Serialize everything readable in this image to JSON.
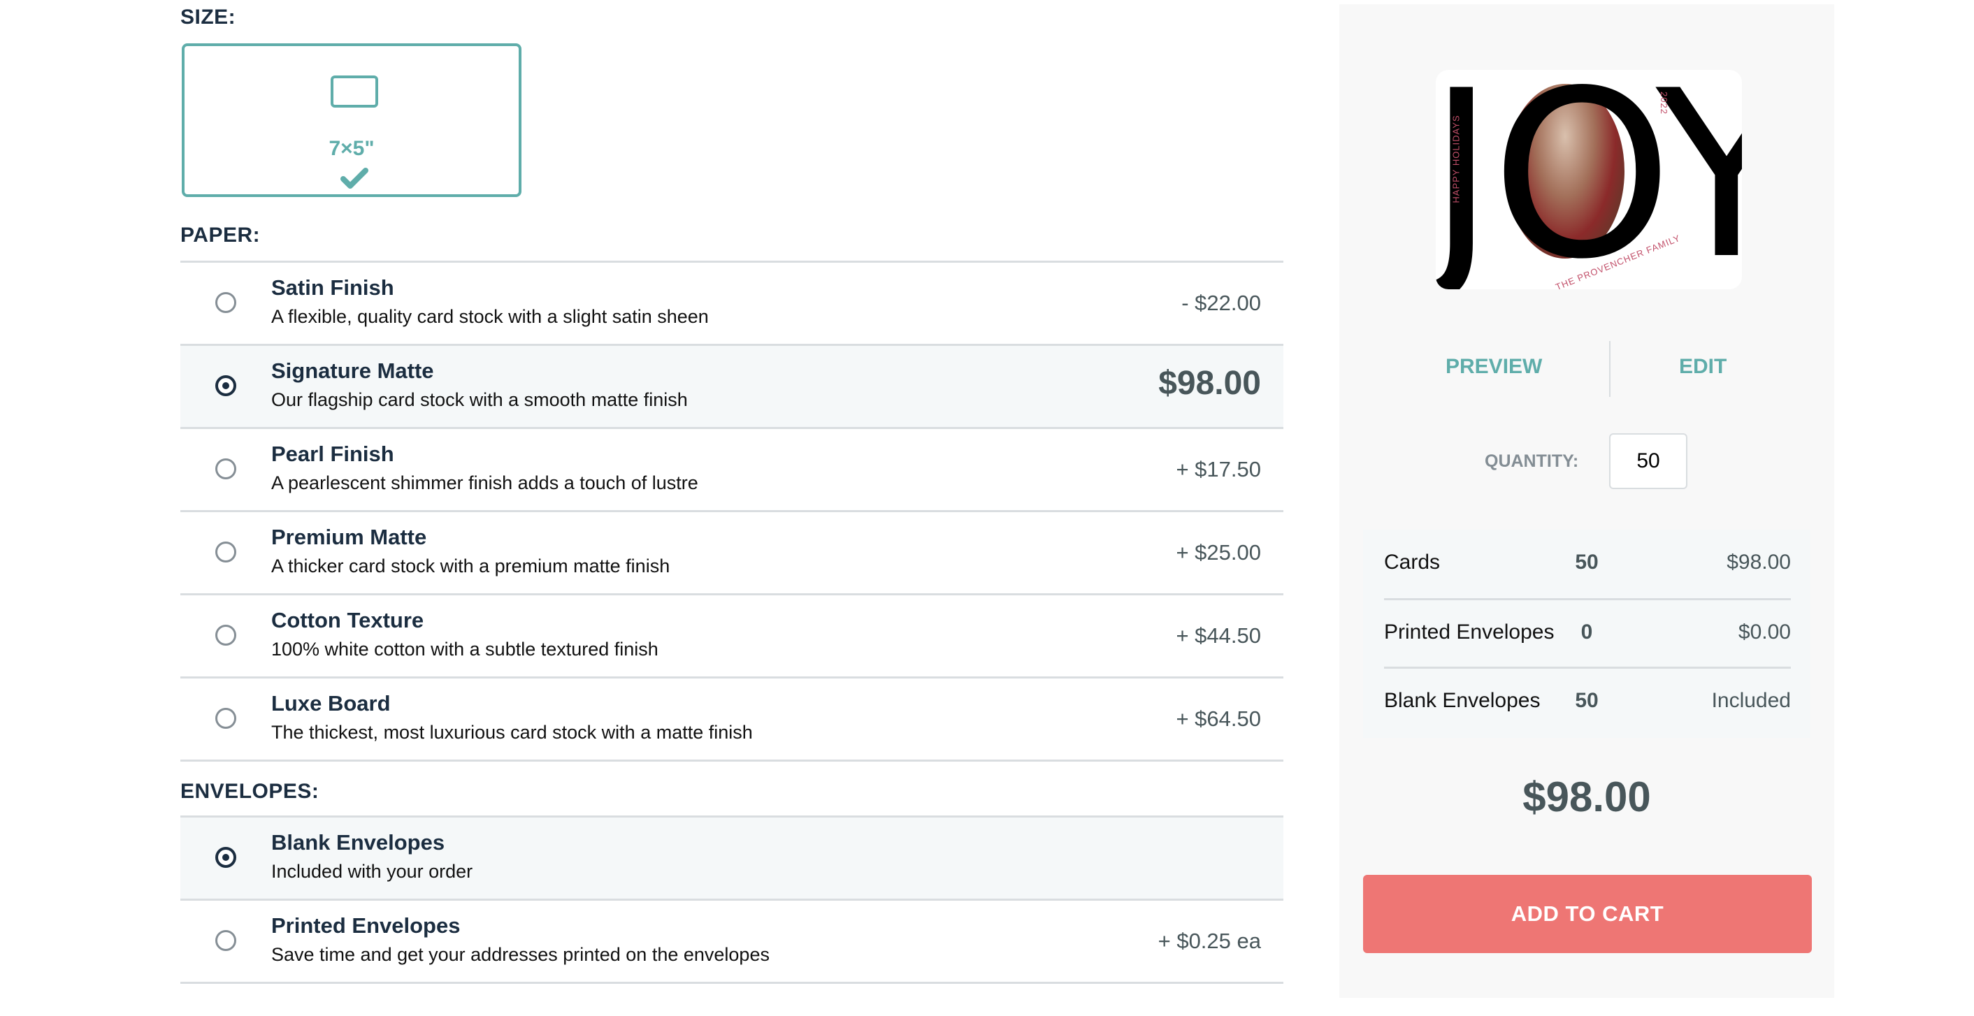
{
  "size": {
    "label": "SIZE:",
    "options": [
      {
        "label": "7×5\"",
        "icon": "card-landscape-icon",
        "selected": true
      }
    ]
  },
  "paper": {
    "label": "PAPER:",
    "options": [
      {
        "title": "Satin Finish",
        "description": "A flexible, quality card stock with a slight satin sheen",
        "price": "- $22.00",
        "selected": false
      },
      {
        "title": "Signature Matte",
        "description": "Our flagship card stock with a smooth matte finish",
        "price": "$98.00",
        "selected": true
      },
      {
        "title": "Pearl Finish",
        "description": "A pearlescent shimmer finish adds a touch of lustre",
        "price": "+ $17.50",
        "selected": false
      },
      {
        "title": "Premium Matte",
        "description": "A thicker card stock with a premium matte finish",
        "price": "+ $25.00",
        "selected": false
      },
      {
        "title": "Cotton Texture",
        "description": "100% white cotton with a subtle textured finish",
        "price": "+ $44.50",
        "selected": false
      },
      {
        "title": "Luxe Board",
        "description": "The thickest, most luxurious card stock with a matte finish",
        "price": "+ $64.50",
        "selected": false
      }
    ]
  },
  "envelopes": {
    "label": "ENVELOPES:",
    "options": [
      {
        "title": "Blank Envelopes",
        "description": "Included with your order",
        "price": "",
        "selected": true
      },
      {
        "title": "Printed Envelopes",
        "description": "Save time and get your addresses printed on the envelopes",
        "price": "+ $0.25 ea",
        "selected": false
      }
    ]
  },
  "panel": {
    "card": {
      "main_text": "JOY",
      "side_text": "HAPPY HOLIDAYS",
      "year": "2022",
      "family": "THE PROVENCHER FAMILY"
    },
    "actions": {
      "preview": "PREVIEW",
      "edit": "EDIT"
    },
    "quantity": {
      "label": "QUANTITY:",
      "value": "50"
    },
    "summary": [
      {
        "name": "Cards",
        "qty": "50",
        "amount": "$98.00"
      },
      {
        "name": "Printed Envelopes",
        "qty": "0",
        "amount": "$0.00"
      },
      {
        "name": "Blank Envelopes",
        "qty": "50",
        "amount": "Included"
      }
    ],
    "total": "$98.00",
    "add_to_cart": "ADD TO CART"
  },
  "colors": {
    "accent": "#5fadaa",
    "heading": "#1b2d40",
    "cta": "#ee7674",
    "price": "#48565a",
    "panel_bg": "#f8f8f8",
    "selected_bg": "#f5f8f9"
  }
}
